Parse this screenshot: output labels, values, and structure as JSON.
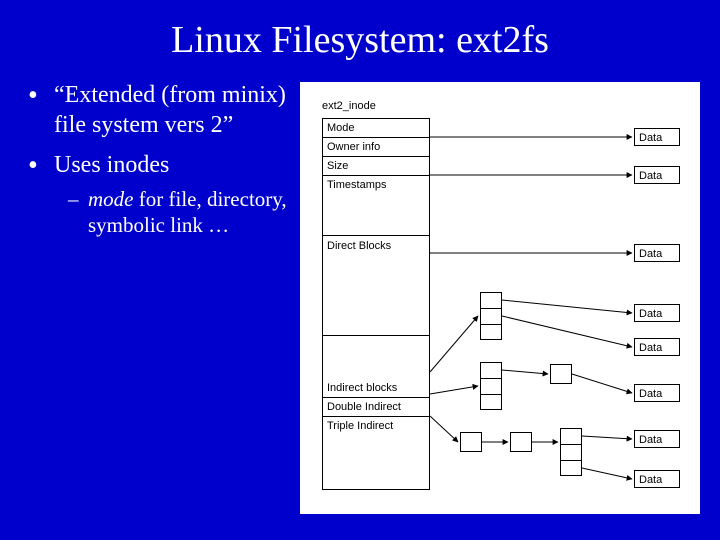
{
  "title": "Linux Filesystem: ext2fs",
  "bullets": {
    "item1": "“Extended (from minix) file system vers 2”",
    "item2": "Uses inodes",
    "sub1_pre": "mode",
    "sub1_post": " for file, directory, symbolic link …"
  },
  "diagram": {
    "inode_title": "ext2_inode",
    "inode_fields": {
      "mode": "Mode",
      "owner": "Owner info",
      "size": "Size",
      "timestamps": "Timestamps",
      "direct": "Direct Blocks",
      "indirect": "Indirect blocks",
      "double": "Double Indirect",
      "triple": "Triple Indirect"
    },
    "data_label": "Data"
  },
  "chart_data": {
    "type": "table",
    "title": "ext2_inode structure",
    "inode_fields": [
      "Mode",
      "Owner info",
      "Size",
      "Timestamps",
      "Direct Blocks",
      "Indirect blocks",
      "Double Indirect",
      "Triple Indirect"
    ],
    "direct_data_blocks_shown": 3,
    "indirect_data_blocks_shown": 2,
    "double_indirect_data_blocks_shown": 1,
    "triple_indirect_data_blocks_shown": 2,
    "pointer_boxes": [
      {
        "level": "indirect",
        "slots": 3
      },
      {
        "level": "double-l1",
        "slots": 3
      },
      {
        "level": "double-l2",
        "slots": 1
      },
      {
        "level": "triple-l1",
        "slots": 1
      },
      {
        "level": "triple-l2",
        "slots": 1
      },
      {
        "level": "triple-l3",
        "slots": 3
      }
    ]
  }
}
